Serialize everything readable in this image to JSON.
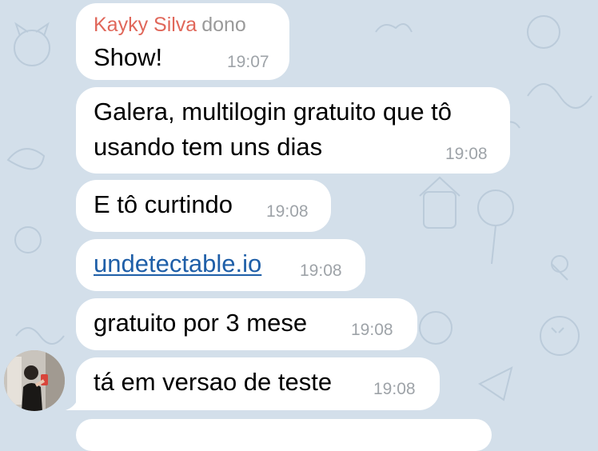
{
  "chat": {
    "first_message": {
      "sender_name": "Kayky Silva",
      "sender_role": "dono",
      "text": "Show!",
      "time": "19:07"
    },
    "messages": [
      {
        "text_line1": "Galera, multilogin gratuito que tô",
        "text_line2": "usando tem uns dias",
        "time": "19:08"
      },
      {
        "text": "E tô curtindo",
        "time": "19:08"
      },
      {
        "text": "undetectable.io",
        "time": "19:08",
        "is_link": true
      },
      {
        "text": "gratuito por 3 mese",
        "time": "19:08"
      },
      {
        "text": "tá em versao de teste",
        "time": "19:08"
      }
    ]
  },
  "colors": {
    "background": "#d3dfea",
    "bubble": "#ffffff",
    "sender_name": "#e0675a",
    "link": "#1f5fa8",
    "timestamp": "#9ea3a8"
  },
  "icons": [
    "user-avatar"
  ]
}
